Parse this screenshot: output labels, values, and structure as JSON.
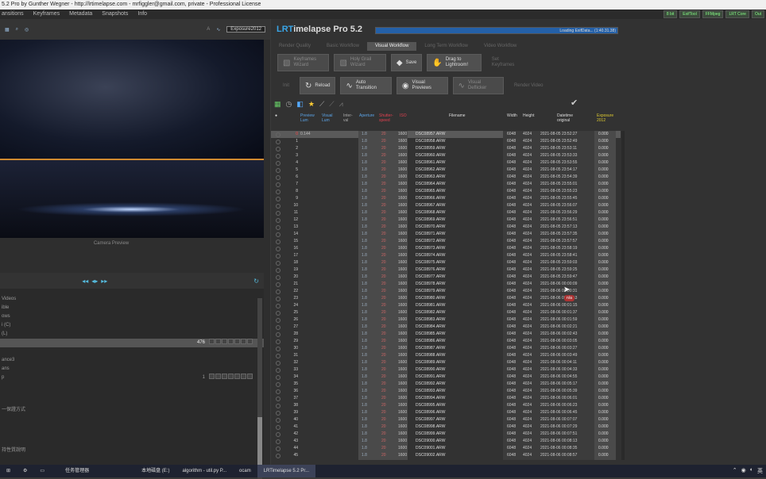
{
  "window": {
    "title": "5.2 Pro by Gunther Wegner - http://lrtimelapse.com - mrfiggler@gmail.com, private - Professional License"
  },
  "menu": [
    "ansitions",
    "Keyframes",
    "Metadata",
    "Snapshots",
    "Info"
  ],
  "top_buttons": [
    "8 bit",
    "ExifTool",
    "FFMpeg",
    "LRT Core",
    "Out"
  ],
  "left": {
    "toolbar": {
      "a": "A",
      "b": "Exposure2012"
    },
    "preview_label": "Camera Preview",
    "panel_rows": [
      {
        "label": "Videos",
        "bar": false
      },
      {
        "label": "ible",
        "bar": false
      },
      {
        "label": "ows",
        "bar": false
      },
      {
        "label": "i (C)",
        "bar": false
      },
      {
        "label": "(L)",
        "bar": false
      },
      {
        "label": "",
        "bar": true,
        "value": "476"
      },
      {
        "label": "",
        "bar": false
      },
      {
        "label": "ance3",
        "bar": false
      },
      {
        "label": "ans",
        "bar": false
      },
      {
        "label": "p",
        "bar": false,
        "value": "1"
      }
    ],
    "side_text_1": "一保證方式",
    "side_text_2": "持性質說明"
  },
  "brand": {
    "lr": "LRT",
    "rest": "imelapse Pro 5.2"
  },
  "loading": {
    "text": "Loading ExifData... (1:40.31.38)",
    "progress": 1.0
  },
  "tabs": [
    {
      "label": "Render Quality",
      "active": false
    },
    {
      "label": "Basic Workflow",
      "active": false
    },
    {
      "label": "Visual Workflow",
      "active": true
    },
    {
      "label": "Long Term Workflow",
      "active": false
    },
    {
      "label": "Video Workflow",
      "active": false
    }
  ],
  "row1": [
    {
      "label": "Keyframes Wizard",
      "icon": "▧",
      "on": false
    },
    {
      "label": "Holy Grail Wizard",
      "icon": "▧",
      "on": false
    },
    {
      "label": "Save",
      "icon": "◆",
      "on": true
    },
    {
      "label": "Drag to Lightroom!",
      "icon": "✋",
      "on": true
    },
    {
      "label": "Set Keyframes",
      "icon": "",
      "on": false
    }
  ],
  "row2": [
    {
      "label": "Init",
      "icon": "",
      "on": false
    },
    {
      "label": "Reload",
      "icon": "↻",
      "on": true
    },
    {
      "label": "Auto Transition",
      "icon": "∿",
      "on": true
    },
    {
      "label": "Visual Previews",
      "icon": "◉",
      "on": true
    },
    {
      "label": "Visual Deflicker",
      "icon": "∿",
      "on": false
    },
    {
      "label": "Render Video",
      "icon": "",
      "on": false
    }
  ],
  "columns": {
    "radio": "●",
    "preview_lum": "Preview Lum",
    "visual_lum": "Visual Lum",
    "interval": "Inter-val",
    "aperture": "Aperture",
    "shutter": "Shutter-speed",
    "iso": "ISO",
    "filename": "Filename",
    "width": "Width",
    "height": "Height",
    "date": "Datetime original",
    "exposure": "Exposure 2012"
  },
  "rows": [
    {
      "i": "0",
      "plum": "0.144",
      "f": "DSC08957.ARW",
      "d": "2021-08-05 23:52:27"
    },
    {
      "i": "1",
      "plum": "",
      "f": "DSC08958.ARW",
      "d": "2021-08-05 23:52:49"
    },
    {
      "i": "2",
      "plum": "",
      "f": "DSC08959.ARW",
      "d": "2021-08-05 23:53:11"
    },
    {
      "i": "3",
      "plum": "",
      "f": "DSC08960.ARW",
      "d": "2021-08-05 23:53:33"
    },
    {
      "i": "4",
      "plum": "",
      "f": "DSC08961.ARW",
      "d": "2021-08-05 23:53:55"
    },
    {
      "i": "5",
      "plum": "",
      "f": "DSC08962.ARW",
      "d": "2021-08-05 23:54:17"
    },
    {
      "i": "6",
      "plum": "",
      "f": "DSC08963.ARW",
      "d": "2021-08-05 23:54:39"
    },
    {
      "i": "7",
      "plum": "",
      "f": "DSC08964.ARW",
      "d": "2021-08-05 23:55:01"
    },
    {
      "i": "8",
      "plum": "",
      "f": "DSC08965.ARW",
      "d": "2021-08-05 23:55:23"
    },
    {
      "i": "9",
      "plum": "",
      "f": "DSC08966.ARW",
      "d": "2021-08-05 23:55:45"
    },
    {
      "i": "10",
      "plum": "",
      "f": "DSC08967.ARW",
      "d": "2021-08-05 23:56:07"
    },
    {
      "i": "11",
      "plum": "",
      "f": "DSC08968.ARW",
      "d": "2021-08-05 23:56:29"
    },
    {
      "i": "12",
      "plum": "",
      "f": "DSC08969.ARW",
      "d": "2021-08-05 23:56:51"
    },
    {
      "i": "13",
      "plum": "",
      "f": "DSC08970.ARW",
      "d": "2021-08-05 23:57:13"
    },
    {
      "i": "14",
      "plum": "",
      "f": "DSC08971.ARW",
      "d": "2021-08-05 23:57:35"
    },
    {
      "i": "15",
      "plum": "",
      "f": "DSC08972.ARW",
      "d": "2021-08-05 23:57:57"
    },
    {
      "i": "16",
      "plum": "",
      "f": "DSC08973.ARW",
      "d": "2021-08-05 23:58:19"
    },
    {
      "i": "17",
      "plum": "",
      "f": "DSC08974.ARW",
      "d": "2021-08-05 23:58:41"
    },
    {
      "i": "18",
      "plum": "",
      "f": "DSC08975.ARW",
      "d": "2021-08-05 23:59:03"
    },
    {
      "i": "19",
      "plum": "",
      "f": "DSC08976.ARW",
      "d": "2021-08-05 23:59:25"
    },
    {
      "i": "20",
      "plum": "",
      "f": "DSC08977.ARW",
      "d": "2021-08-05 23:59:47"
    },
    {
      "i": "21",
      "plum": "",
      "f": "DSC08978.ARW",
      "d": "2021-08-06 00:00:09"
    },
    {
      "i": "22",
      "plum": "",
      "f": "DSC08979.ARW",
      "d": "2021-08-06 00:00:31"
    },
    {
      "i": "23",
      "plum": "",
      "f": "DSC08980.ARW",
      "d": "2021-08-06 00:00:53"
    },
    {
      "i": "24",
      "plum": "",
      "f": "DSC08981.ARW",
      "d": "2021-08-06 00:01:15"
    },
    {
      "i": "25",
      "plum": "",
      "f": "DSC08982.ARW",
      "d": "2021-08-06 00:01:37"
    },
    {
      "i": "26",
      "plum": "",
      "f": "DSC08983.ARW",
      "d": "2021-08-06 00:01:59"
    },
    {
      "i": "27",
      "plum": "",
      "f": "DSC08984.ARW",
      "d": "2021-08-06 00:02:21"
    },
    {
      "i": "28",
      "plum": "",
      "f": "DSC08985.ARW",
      "d": "2021-08-06 00:02:43"
    },
    {
      "i": "29",
      "plum": "",
      "f": "DSC08986.ARW",
      "d": "2021-08-06 00:03:05"
    },
    {
      "i": "30",
      "plum": "",
      "f": "DSC08987.ARW",
      "d": "2021-08-06 00:03:27"
    },
    {
      "i": "31",
      "plum": "",
      "f": "DSC08988.ARW",
      "d": "2021-08-06 00:03:49"
    },
    {
      "i": "32",
      "plum": "",
      "f": "DSC08989.ARW",
      "d": "2021-08-06 00:04:11"
    },
    {
      "i": "33",
      "plum": "",
      "f": "DSC08990.ARW",
      "d": "2021-08-06 00:04:33"
    },
    {
      "i": "34",
      "plum": "",
      "f": "DSC08991.ARW",
      "d": "2021-08-06 00:04:55"
    },
    {
      "i": "35",
      "plum": "",
      "f": "DSC08992.ARW",
      "d": "2021-08-06 00:05:17"
    },
    {
      "i": "36",
      "plum": "",
      "f": "DSC08993.ARW",
      "d": "2021-08-06 00:05:39"
    },
    {
      "i": "37",
      "plum": "",
      "f": "DSC08994.ARW",
      "d": "2021-08-06 00:06:01"
    },
    {
      "i": "38",
      "plum": "",
      "f": "DSC08995.ARW",
      "d": "2021-08-06 00:06:23"
    },
    {
      "i": "39",
      "plum": "",
      "f": "DSC08996.ARW",
      "d": "2021-08-06 00:06:45"
    },
    {
      "i": "40",
      "plum": "",
      "f": "DSC08997.ARW",
      "d": "2021-08-06 00:07:07"
    },
    {
      "i": "41",
      "plum": "",
      "f": "DSC08998.ARW",
      "d": "2021-08-06 00:07:29"
    },
    {
      "i": "42",
      "plum": "",
      "f": "DSC08999.ARW",
      "d": "2021-08-06 00:07:51"
    },
    {
      "i": "43",
      "plum": "",
      "f": "DSC09000.ARW",
      "d": "2021-08-06 00:08:13"
    },
    {
      "i": "44",
      "plum": "",
      "f": "DSC09001.ARW",
      "d": "2021-08-06 00:08:35"
    },
    {
      "i": "45",
      "plum": "",
      "f": "DSC09002.ARW",
      "d": "2021-08-06 00:08:57"
    },
    {
      "i": "46",
      "plum": "",
      "f": "DSC09003.ARW",
      "d": "2021-08-06 00:09:19"
    }
  ],
  "row_const": {
    "ap": "1.8",
    "sh": "20",
    "iso": "1600",
    "w": "6048",
    "h": "4024",
    "exp": "0.000"
  },
  "cursor_tag": "n/a",
  "taskbar": [
    {
      "label": "任务管理器",
      "active": false
    },
    {
      "label": "本地磁盘 (E:)",
      "active": false
    },
    {
      "label": "algorithm - util.py P...",
      "active": false
    },
    {
      "label": "ocam",
      "active": false
    },
    {
      "label": "LRTimelapse 5.2 Pr...",
      "active": true
    }
  ],
  "tray_lang": "英"
}
